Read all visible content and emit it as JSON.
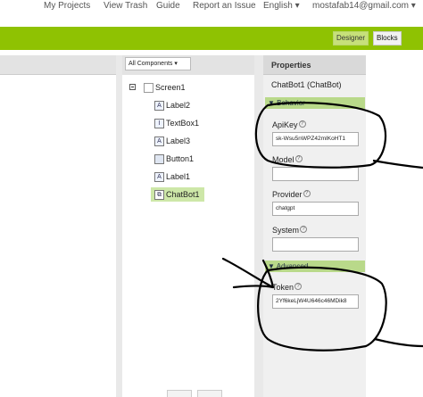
{
  "topnav": {
    "my_projects": "My Projects",
    "view_trash": "View Trash",
    "guide": "Guide",
    "report_issue": "Report an Issue",
    "language": "English ▾",
    "account": "mostafab14@gmail.com ▾"
  },
  "toolbar": {
    "designer_label": "Designer",
    "blocks_label": "Blocks"
  },
  "components": {
    "dropdown_label": "All Components ▾",
    "tree": [
      {
        "name": "Screen1",
        "icon": "screen-icon"
      },
      {
        "name": "Label2",
        "icon": "label-icon",
        "glyph": "A"
      },
      {
        "name": "TextBox1",
        "icon": "textbox-icon",
        "glyph": "I"
      },
      {
        "name": "Label3",
        "icon": "label-icon",
        "glyph": "A"
      },
      {
        "name": "Button1",
        "icon": "button-icon",
        "glyph": ""
      },
      {
        "name": "Label1",
        "icon": "label-icon",
        "glyph": "A"
      },
      {
        "name": "ChatBot1",
        "icon": "chatbot-icon",
        "glyph": "⧉",
        "selected": true
      }
    ]
  },
  "properties": {
    "header": "Properties",
    "title": "ChatBot1 (ChatBot)",
    "behavior_label": "▼ Behavior",
    "apikey_label": "ApiKey",
    "apikey_value": "sk-Wsu5nWPZ42mIKoHT1",
    "model_label": "Model",
    "model_value": "",
    "provider_label": "Provider",
    "provider_value": "chatgpt",
    "system_label": "System",
    "system_value": "",
    "advanced_label": "▼ Advanced",
    "token_label": "Token",
    "token_value": "2Yf6keLjW4U646c46MDik8",
    "help_glyph": "?"
  },
  "colors": {
    "toolbar_green": "#8fc202",
    "selection_green": "#cde7a8",
    "section_green": "#b9d98a"
  }
}
